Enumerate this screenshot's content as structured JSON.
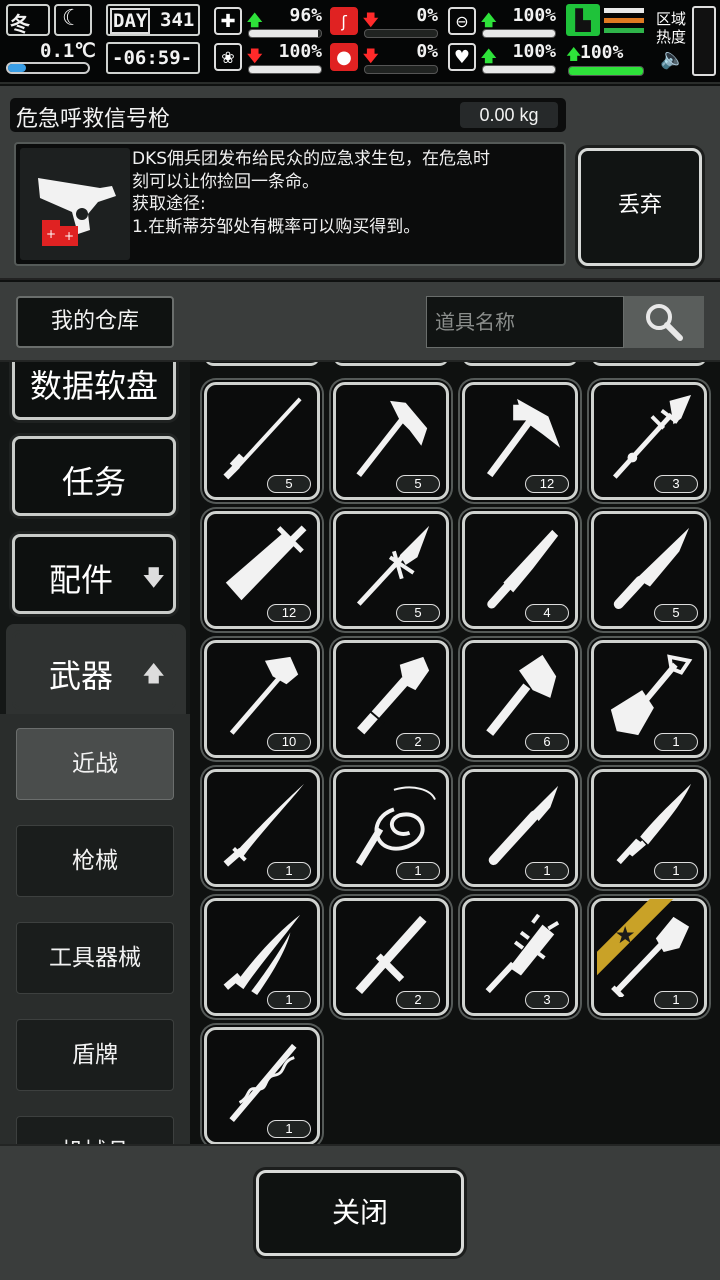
{
  "hud": {
    "season": "冬",
    "temperature": "0.1℃",
    "day_label": "DAY",
    "day_number": "341",
    "time": "-06:59-",
    "region_heat_label": "区域热度",
    "stats": [
      {
        "name": "health",
        "value": "96%",
        "trend": "up",
        "level": 0.96
      },
      {
        "name": "hunger",
        "value": "0%",
        "trend": "down",
        "level": 0.0
      },
      {
        "name": "thirst-stamina",
        "value": "100%",
        "trend": "up",
        "level": 1.0
      },
      {
        "name": "mental",
        "value": "100%",
        "trend": "down",
        "level": 1.0
      },
      {
        "name": "blood",
        "value": "0%",
        "trend": "down",
        "level": 0.0
      },
      {
        "name": "mood",
        "value": "100%",
        "trend": "up",
        "level": 1.0
      },
      {
        "name": "energy",
        "value": "100%",
        "trend": "up",
        "level": 1.0
      }
    ]
  },
  "detail": {
    "item_name": "危急呼救信号枪",
    "weight": "0.00 kg",
    "description": "DKS佣兵团发布给民众的应急求生包，在危急时\n刻可以让你捡回一条命。\n获取途径:\n1.在斯蒂芬邹处有概率可以购买得到。",
    "discard_label": "丢弃"
  },
  "warehouse": {
    "label": "我的仓库",
    "search_placeholder": "道具名称"
  },
  "categories": [
    {
      "label": "数据软盘",
      "arrow": ""
    },
    {
      "label": "任务",
      "arrow": ""
    },
    {
      "label": "配件",
      "arrow": "🡇"
    },
    {
      "label": "武器",
      "arrow": "🡅"
    }
  ],
  "subcategories": [
    "近战",
    "枪械",
    "工具器械",
    "盾牌",
    "机械品"
  ],
  "selected_subcategory": "近战",
  "items": [
    {
      "icon": "sword-stick-icon",
      "count": "5"
    },
    {
      "icon": "axe-icon",
      "count": "5"
    },
    {
      "icon": "hammer-axe-icon",
      "count": "12"
    },
    {
      "icon": "spear-icon",
      "count": "3"
    },
    {
      "icon": "broadsword-icon",
      "count": "12"
    },
    {
      "icon": "spear-tip-icon",
      "count": "5"
    },
    {
      "icon": "machete-icon",
      "count": "4"
    },
    {
      "icon": "combat-knife-icon",
      "count": "5"
    },
    {
      "icon": "fire-axe-icon",
      "count": "10"
    },
    {
      "icon": "pipe-wrench-icon",
      "count": "2"
    },
    {
      "icon": "hatchet-icon",
      "count": "6"
    },
    {
      "icon": "shovel-icon",
      "count": "1"
    },
    {
      "icon": "katana-icon",
      "count": "1"
    },
    {
      "icon": "whip-icon",
      "count": "1"
    },
    {
      "icon": "scalpel-icon",
      "count": "1"
    },
    {
      "icon": "serrated-blade-icon",
      "count": "1"
    },
    {
      "icon": "twin-katana-icon",
      "count": "1"
    },
    {
      "icon": "tonfa-icon",
      "count": "2"
    },
    {
      "icon": "spiked-club-icon",
      "count": "3"
    },
    {
      "icon": "spade-icon",
      "count": "1",
      "starred": true
    },
    {
      "icon": "vine-staff-icon",
      "count": "1"
    }
  ],
  "close_label": "关闭"
}
